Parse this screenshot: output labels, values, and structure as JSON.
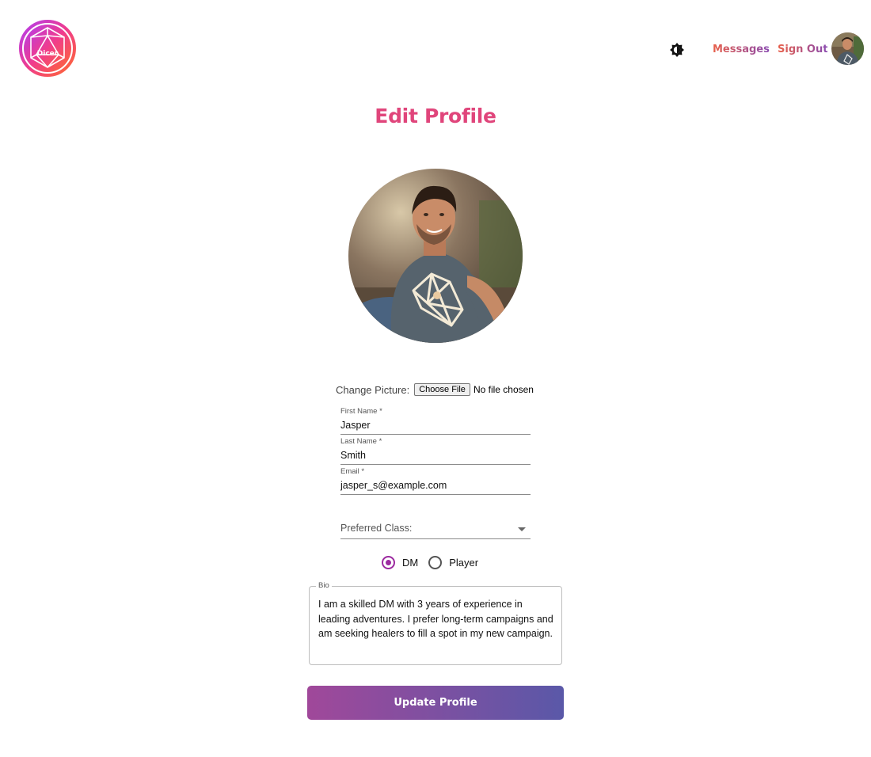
{
  "header": {
    "logo_text": "Dicer",
    "theme_toggle_icon": "brightness-icon",
    "nav": {
      "messages": "Messages",
      "sign_out": "Sign Out"
    }
  },
  "page_title": "Edit Profile",
  "change_picture": {
    "label": "Change Picture:",
    "button_label": "Choose File",
    "status": "No file chosen"
  },
  "form": {
    "first_name": {
      "label": "First Name *",
      "value": "Jasper"
    },
    "last_name": {
      "label": "Last Name *",
      "value": "Smith"
    },
    "email": {
      "label": "Email *",
      "value": "jasper_s@example.com"
    },
    "preferred_class": {
      "label": "Preferred Class:",
      "value": ""
    },
    "role_options": [
      {
        "label": "DM",
        "checked": true
      },
      {
        "label": "Player",
        "checked": false
      }
    ],
    "bio": {
      "label": "Bio",
      "value": "I am a skilled DM with 3 years of experience in leading adventures. I prefer long-term campaigns and am seeking healers to fill a spot in my new campaign."
    },
    "submit_label": "Update Profile"
  },
  "colors": {
    "title": "#e0457b",
    "accent_purple": "#9c2aa0",
    "button_gradient_start": "#a0489a",
    "button_gradient_end": "#5a58a8",
    "nav_gradient_start": "#e8604a",
    "nav_gradient_end": "#8a4bb0"
  }
}
